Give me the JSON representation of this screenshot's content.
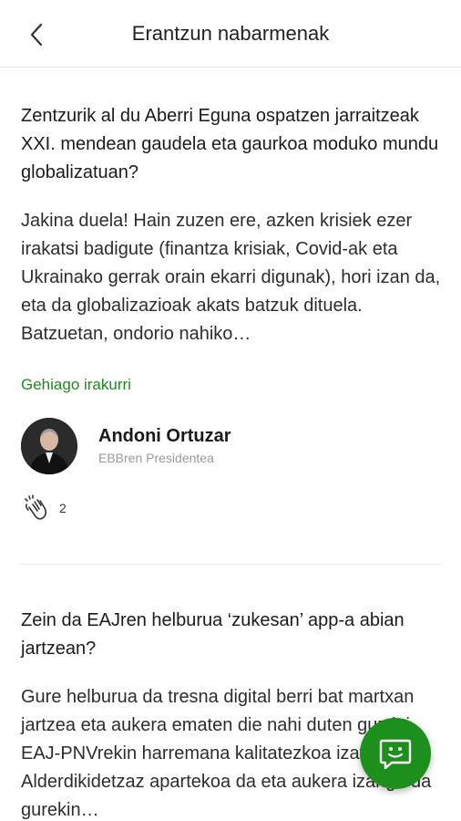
{
  "header": {
    "title": "Erantzun nabarmenak",
    "back_icon": "chevron-left-icon"
  },
  "cards": [
    {
      "question": "Zentzurik al du Aberri Eguna ospatzen jarraitzeak XXI. mendean gaudela eta gaurkoa moduko mundu globalizatuan?",
      "answer": "Jakina duela! Hain zuzen ere, azken krisiek ezer irakatsi badigute (finantza krisiak, Covid-ak eta Ukrainako gerrak orain ekarri digunak), hori izan da, eta da globalizazioak akats batzuk dituela. Batzuetan, ondorio nahiko…",
      "read_more": "Gehiago irakurri",
      "author_name": "Andoni Ortuzar",
      "author_role": "EBBren Presidentea",
      "clap_count": "2"
    },
    {
      "question": "Zein da EAJren helburua ‘zukesan’ app-a abian jartzean?",
      "answer": "Gure helburua da tresna digital berri bat martxan jartzea eta aukera ematen die nahi duten guztiei, EAJ-PNVrekin harremana kalitatezkoa izateko. Alderdikidetzaz apartekoa da eta aukera izango da gurekin…"
    }
  ],
  "fab": {
    "icon": "chat-smiley-icon"
  },
  "colors": {
    "accent": "#1e8a1e",
    "fab": "#1d8f1d",
    "divider": "#e6e6e6"
  }
}
